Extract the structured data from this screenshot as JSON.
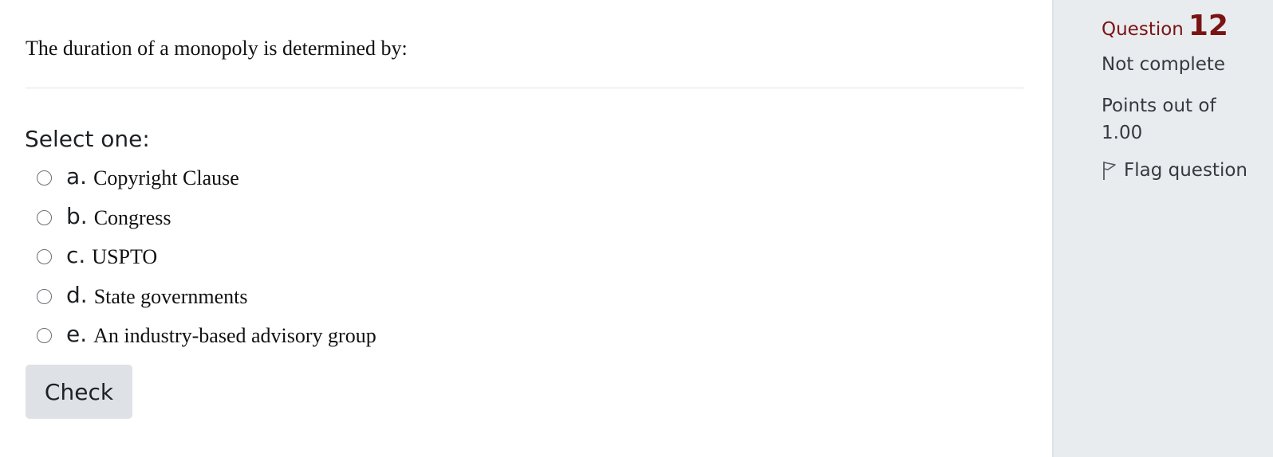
{
  "question": {
    "text": "The duration of a monopoly is determined by:",
    "prompt": "Select one:",
    "options": [
      {
        "letter": "a.",
        "text": "Copyright Clause"
      },
      {
        "letter": "b.",
        "text": "Congress"
      },
      {
        "letter": "c.",
        "text": "USPTO"
      },
      {
        "letter": "d.",
        "text": "State governments"
      },
      {
        "letter": "e.",
        "text": "An industry-based advisory group"
      }
    ],
    "check_label": "Check"
  },
  "info": {
    "label": "Question",
    "number": "12",
    "status": "Not complete",
    "grade": "Points out of 1.00",
    "flag_label": "Flag question",
    "flag_icon": "flag-outline-icon"
  },
  "colors": {
    "question_number": "#7a1414",
    "panel_background": "#e9ecef",
    "button_background": "#dee2e6"
  }
}
